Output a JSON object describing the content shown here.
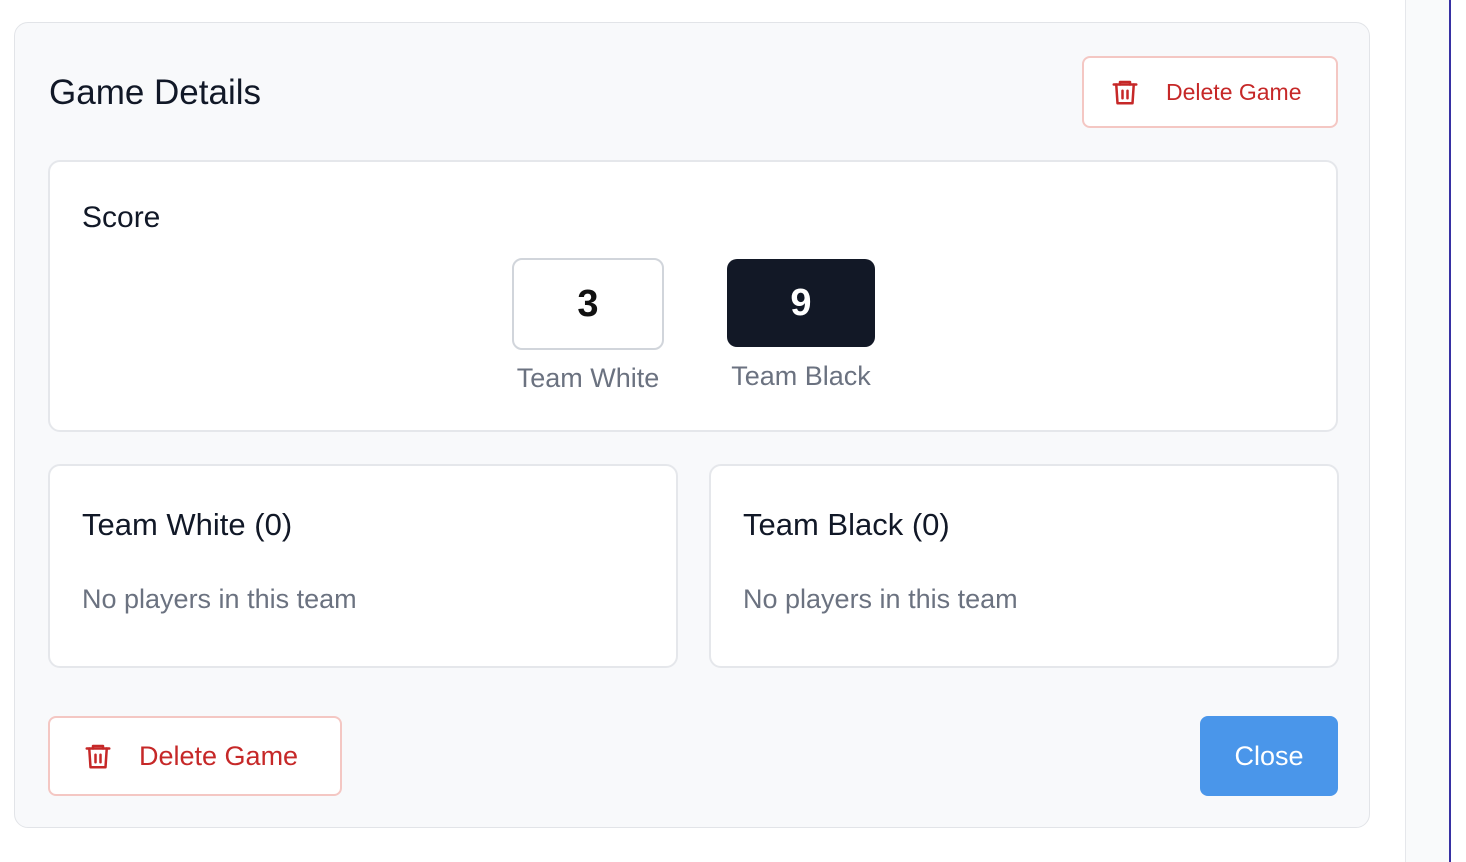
{
  "dialog": {
    "title": "Game Details",
    "delete_top_label": "Delete Game",
    "delete_bottom_label": "Delete Game",
    "close_label": "Close"
  },
  "score": {
    "title": "Score",
    "team_white": {
      "value": "3",
      "label": "Team White"
    },
    "team_black": {
      "value": "9",
      "label": "Team Black"
    }
  },
  "teams": {
    "white": {
      "title": "Team White (0)",
      "empty_text": "No players in this team"
    },
    "black": {
      "title": "Team Black (0)",
      "empty_text": "No players in this team"
    }
  },
  "icons": {
    "delete": "trash-icon"
  },
  "colors": {
    "danger": "#c62828",
    "danger_border": "#f4c7c3",
    "primary": "#4a96ea",
    "dark": "#121826",
    "muted": "#6b7280"
  }
}
